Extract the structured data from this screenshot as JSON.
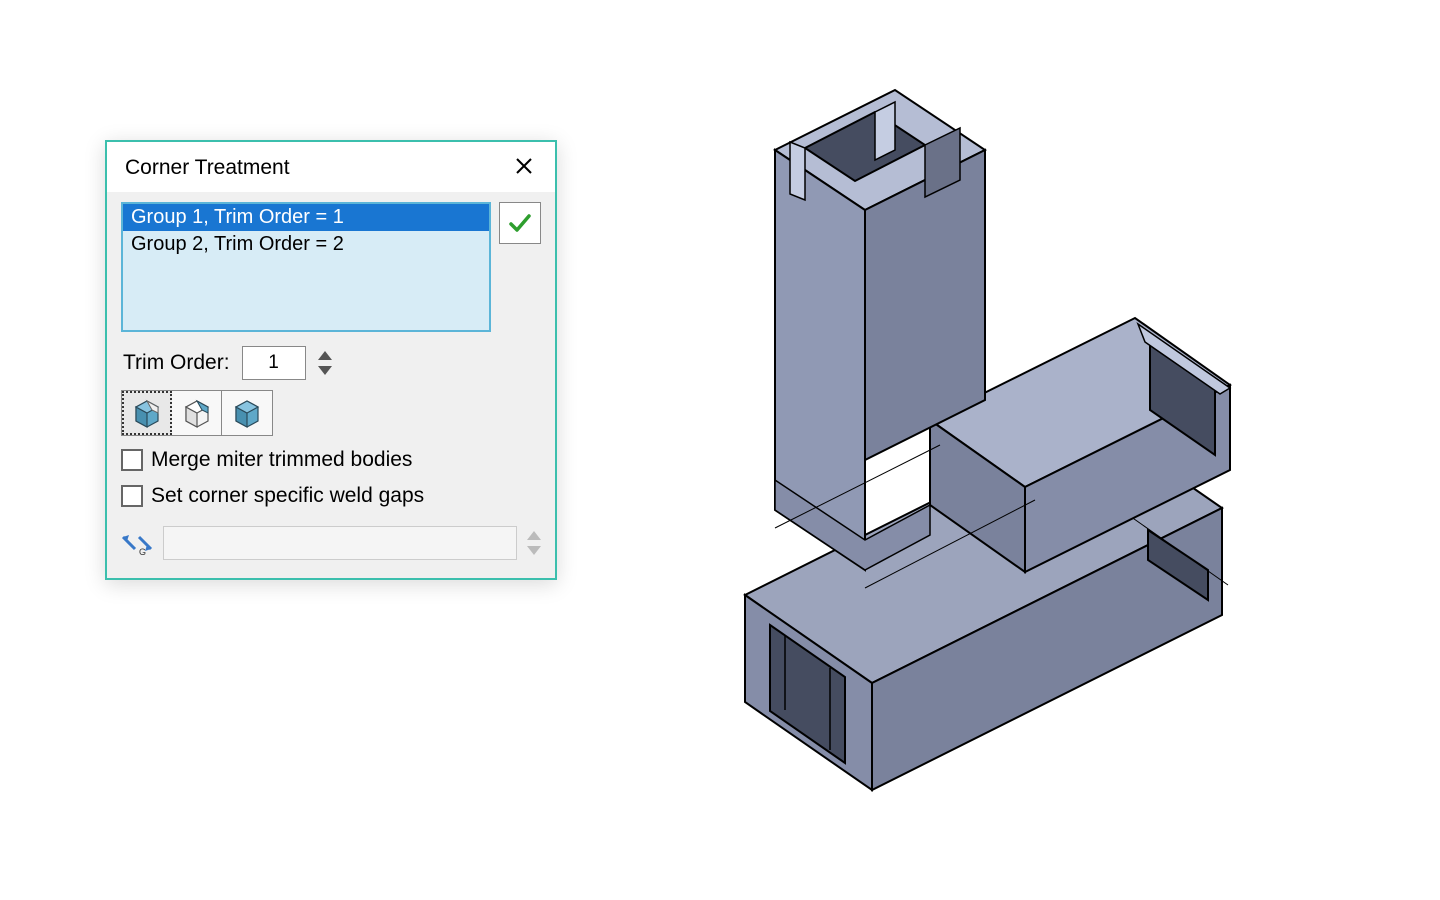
{
  "dialog": {
    "title": "Corner Treatment",
    "groupList": {
      "items": [
        {
          "label": "Group 1, Trim Order = 1",
          "selected": true
        },
        {
          "label": "Group 2, Trim Order = 2",
          "selected": false
        }
      ]
    },
    "trimOrder": {
      "label": "Trim Order:",
      "value": "1"
    },
    "treatmentButtons": {
      "names": [
        "trim-type-1-button",
        "trim-type-2-button",
        "trim-type-3-button"
      ],
      "selected": 0
    },
    "checkboxes": {
      "mergeMiter": {
        "label": "Merge miter trimmed bodies",
        "checked": false
      },
      "setWeldGaps": {
        "label": "Set corner specific weld gaps",
        "checked": false
      }
    },
    "gapField": {
      "value": "",
      "enabled": false
    }
  },
  "colors": {
    "accent": "#3bbfad",
    "selection": "#1976d2",
    "listBg": "#d7ecf6"
  }
}
